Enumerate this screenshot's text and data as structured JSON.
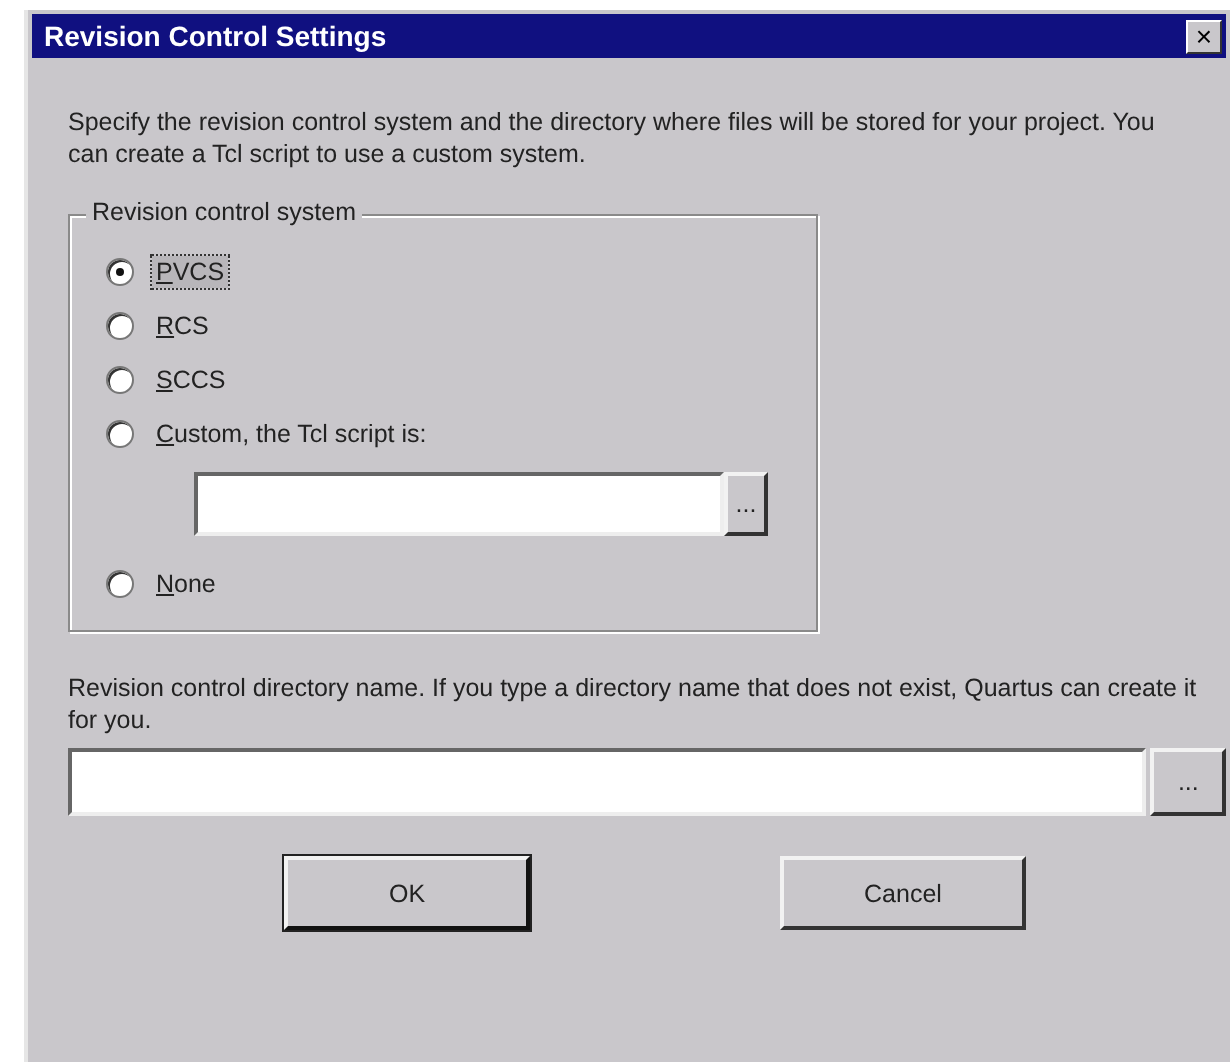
{
  "window": {
    "title": "Revision Control Settings",
    "close": "×"
  },
  "intro": "Specify the revision control system and the directory where files will be stored for your project.  You can create a Tcl script to use a custom system.",
  "group": {
    "legend": "Revision control system",
    "options": [
      {
        "kind": "radio",
        "label": "PVCS",
        "selected": true,
        "focused": true,
        "mnemonic_first": true
      },
      {
        "kind": "radio",
        "label": "RCS",
        "selected": false,
        "focused": false,
        "mnemonic_first": true
      },
      {
        "kind": "radio",
        "label": "SCCS",
        "selected": false,
        "focused": false,
        "mnemonic_first": true
      },
      {
        "kind": "radio",
        "label": "Custom, the Tcl script is:",
        "selected": false,
        "focused": false,
        "mnemonic_first": true
      },
      {
        "kind": "path",
        "browse": "..."
      },
      {
        "kind": "radio",
        "label": "None",
        "selected": false,
        "focused": false,
        "mnemonic_first": true
      }
    ]
  },
  "directory": {
    "label": "Revision control directory name.  If you type a directory name that does not exist, Quartus can create it for you.",
    "browse": "..."
  },
  "buttons": [
    {
      "label": "OK",
      "default": true
    },
    {
      "label": "Cancel",
      "default": false
    }
  ]
}
